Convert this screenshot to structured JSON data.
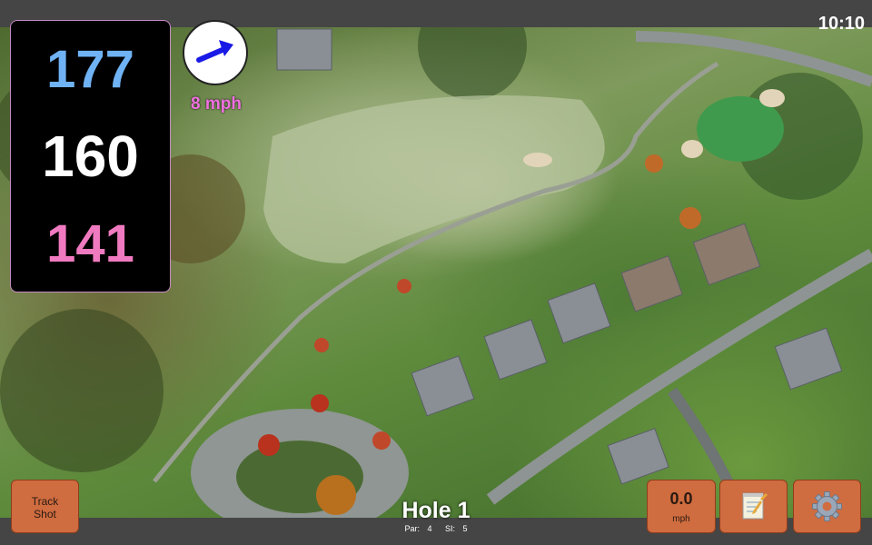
{
  "status_bar": {
    "time": "10:10"
  },
  "distances": {
    "back": "177",
    "middle": "160",
    "front": "141"
  },
  "wind": {
    "speed": "8 mph",
    "arrow_icon": "arrow-right-icon",
    "color": "#1a1ae6"
  },
  "buttons": {
    "track_shot_line1": "Track",
    "track_shot_line2": "Shot",
    "speed_value": "0.0",
    "speed_unit": "mph",
    "notes_icon": "notepad-icon",
    "settings_icon": "gear-icon",
    "accent": "#cf6c40"
  },
  "hole": {
    "title": "Hole 1",
    "par_label": "Par:",
    "par_value": "4",
    "si_label": "SI:",
    "si_value": "5"
  }
}
